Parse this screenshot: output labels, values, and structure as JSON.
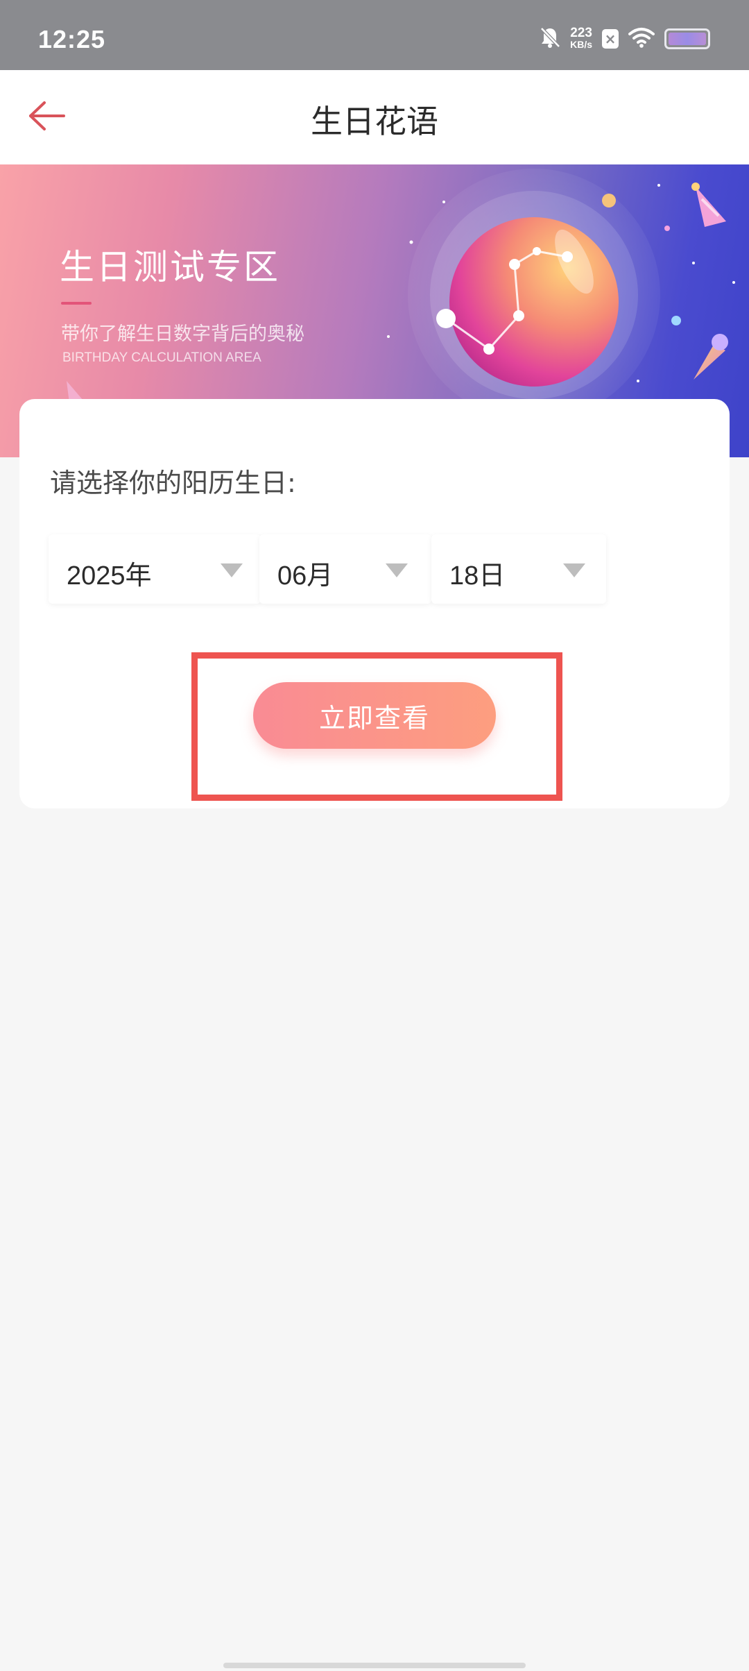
{
  "status_bar": {
    "time": "12:25",
    "net_speed_value": "223",
    "net_speed_unit": "KB/s",
    "icons": [
      "bell-muted-icon",
      "notification-x-icon",
      "wifi-icon",
      "battery-icon"
    ]
  },
  "header": {
    "title": "生日花语",
    "back_icon": "arrow-left-icon"
  },
  "banner": {
    "title": "生日测试专区",
    "subtitle": "带你了解生日数字背后的奥秘",
    "subtitle_en": "BIRTHDAY CALCULATION AREA"
  },
  "form": {
    "prompt": "请选择你的阳历生日:",
    "year": "2025年",
    "month": "06月",
    "day": "18日",
    "submit_label": "立即查看"
  },
  "colors": {
    "accent": "#ee5450",
    "button_start": "#f98b94",
    "button_end": "#fd9e7f",
    "back_arrow": "#d9535a"
  }
}
